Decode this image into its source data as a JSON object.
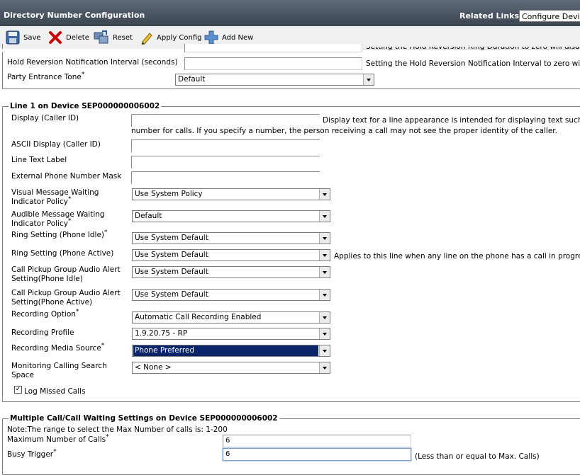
{
  "header": {
    "title": "Directory Number Configuration",
    "related_links_label": "Related Links:",
    "related_links_value": "Configure Device"
  },
  "toolbar": {
    "save": "Save",
    "delete": "Delete",
    "reset": "Reset",
    "apply_config": "Apply Config",
    "add_new": "Add New"
  },
  "top_section": {
    "clipped_help": "Setting the Hold Reversion Ring Duration to zero will disable",
    "hold_reversion_label": "Hold Reversion Notification Interval (seconds)",
    "hold_reversion_value": "",
    "hold_reversion_help": "Setting the Hold Reversion Notification Interval to zero will d",
    "party_entrance_tone_label": "Party Entrance Tone",
    "party_entrance_tone_value": "Default"
  },
  "line_section": {
    "legend": "Line 1 on Device SEP000000006002",
    "display_label": "Display (Caller ID)",
    "display_value": "",
    "display_help_1": "Display text for a line appearance is intended for displaying text such as",
    "display_help_2": "number for calls. If you specify a number, the person receiving a call may not see the proper identity of the caller.",
    "ascii_display_label": "ASCII Display (Caller ID)",
    "ascii_display_value": "",
    "line_text_label_label": "Line Text Label",
    "line_text_label_value": "",
    "external_mask_label": "External Phone Number Mask",
    "external_mask_value": "",
    "visual_mwi_label_1": "Visual Message Waiting",
    "visual_mwi_label_2": "Indicator Policy",
    "visual_mwi_value": "Use System Policy",
    "audible_mwi_label_1": "Audible Message Waiting",
    "audible_mwi_label_2": "Indicator Policy",
    "audible_mwi_value": "Default",
    "ring_idle_label": "Ring Setting (Phone Idle)",
    "ring_idle_value": "Use System Default",
    "ring_active_label": "Ring Setting (Phone Active)",
    "ring_active_value": "Use System Default",
    "ring_active_help": "Applies to this line when any line on the phone has a call in progress.",
    "pickup_idle_label_1": "Call Pickup Group Audio Alert",
    "pickup_idle_label_2": "Setting(Phone Idle)",
    "pickup_idle_value": "Use System Default",
    "pickup_active_label_1": "Call Pickup Group Audio Alert",
    "pickup_active_label_2": "Setting(Phone Active)",
    "pickup_active_value": "Use System Default",
    "recording_option_label": "Recording Option",
    "recording_option_value": "Automatic Call Recording Enabled",
    "recording_profile_label": "Recording Profile",
    "recording_profile_value": "1.9.20.75 - RP",
    "recording_media_label": "Recording Media Source",
    "recording_media_value": "Phone Preferred",
    "monitoring_css_label_1": "Monitoring Calling Search",
    "monitoring_css_label_2": "Space",
    "monitoring_css_value": "< None >",
    "log_missed_label": "Log Missed Calls",
    "log_missed_checked": "✓"
  },
  "multi_section": {
    "legend": "Multiple Call/Call Waiting Settings on Device SEP000000006002",
    "note": "Note:The range to select the Max Number of calls is: 1-200",
    "max_calls_label": "Maximum Number of Calls",
    "max_calls_value": "6",
    "busy_trigger_label": "Busy Trigger",
    "busy_trigger_value": "6",
    "busy_trigger_help": "(Less than or equal to Max. Calls)"
  },
  "required_marker": "*",
  "colors": {
    "header_bg": "#4a5561",
    "selection": "#0a246a",
    "delete_red": "#cc0000"
  }
}
